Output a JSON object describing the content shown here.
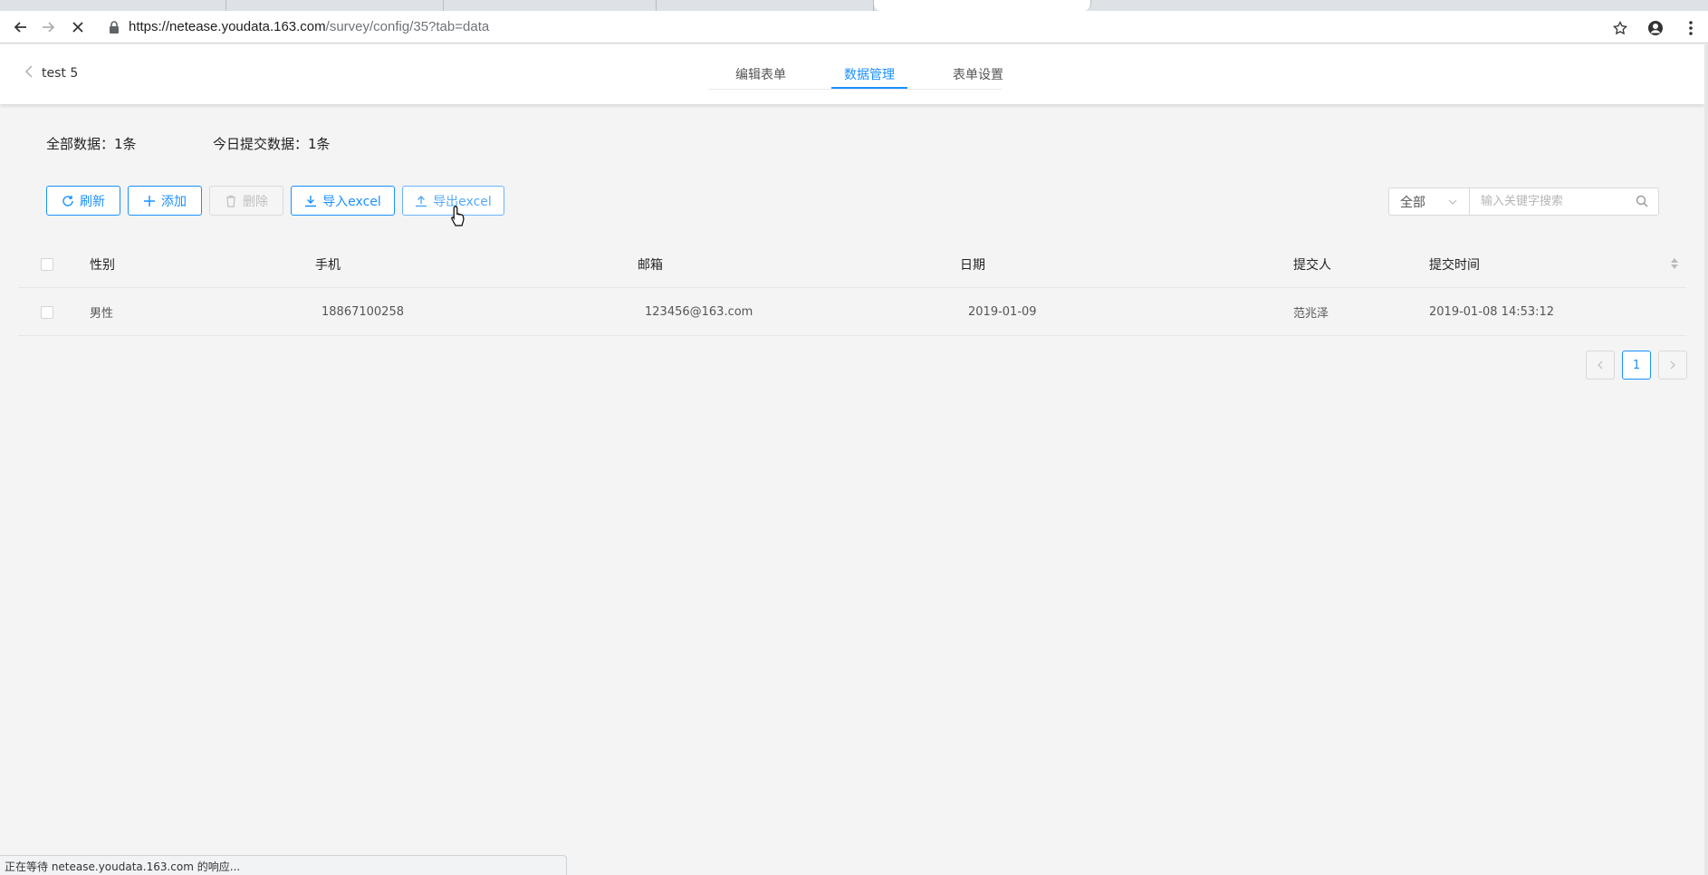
{
  "browser": {
    "url_main": "https://netease.youdata.163.com",
    "url_path": "/survey/config/35?tab=data",
    "status_text": "正在等待 netease.youdata.163.com 的响应..."
  },
  "header": {
    "back_title": "test 5",
    "tabs": [
      {
        "label": "编辑表单"
      },
      {
        "label": "数据管理"
      },
      {
        "label": "表单设置"
      }
    ]
  },
  "stats": {
    "total": "全部数据：1条",
    "today": "今日提交数据：1条"
  },
  "actions": {
    "refresh": "刷新",
    "add": "添加",
    "delete": "删除",
    "import": "导入excel",
    "export": "导出excel"
  },
  "filter": {
    "selected": "全部",
    "search_placeholder": "输入关键字搜索"
  },
  "table": {
    "columns": [
      "性别",
      "手机",
      "邮箱",
      "日期",
      "提交人",
      "提交时间"
    ],
    "rows": [
      [
        "男性",
        "18867100258",
        "123456@163.com",
        "2019-01-09",
        "范兆泽",
        "2019-01-08 14:53:12"
      ]
    ]
  },
  "pagination": {
    "current": "1",
    "prev_icon": "chevron-left-icon",
    "next_icon": "chevron-right-icon"
  },
  "colors": {
    "accent": "#1890ff",
    "background": "#f4f4f4"
  }
}
